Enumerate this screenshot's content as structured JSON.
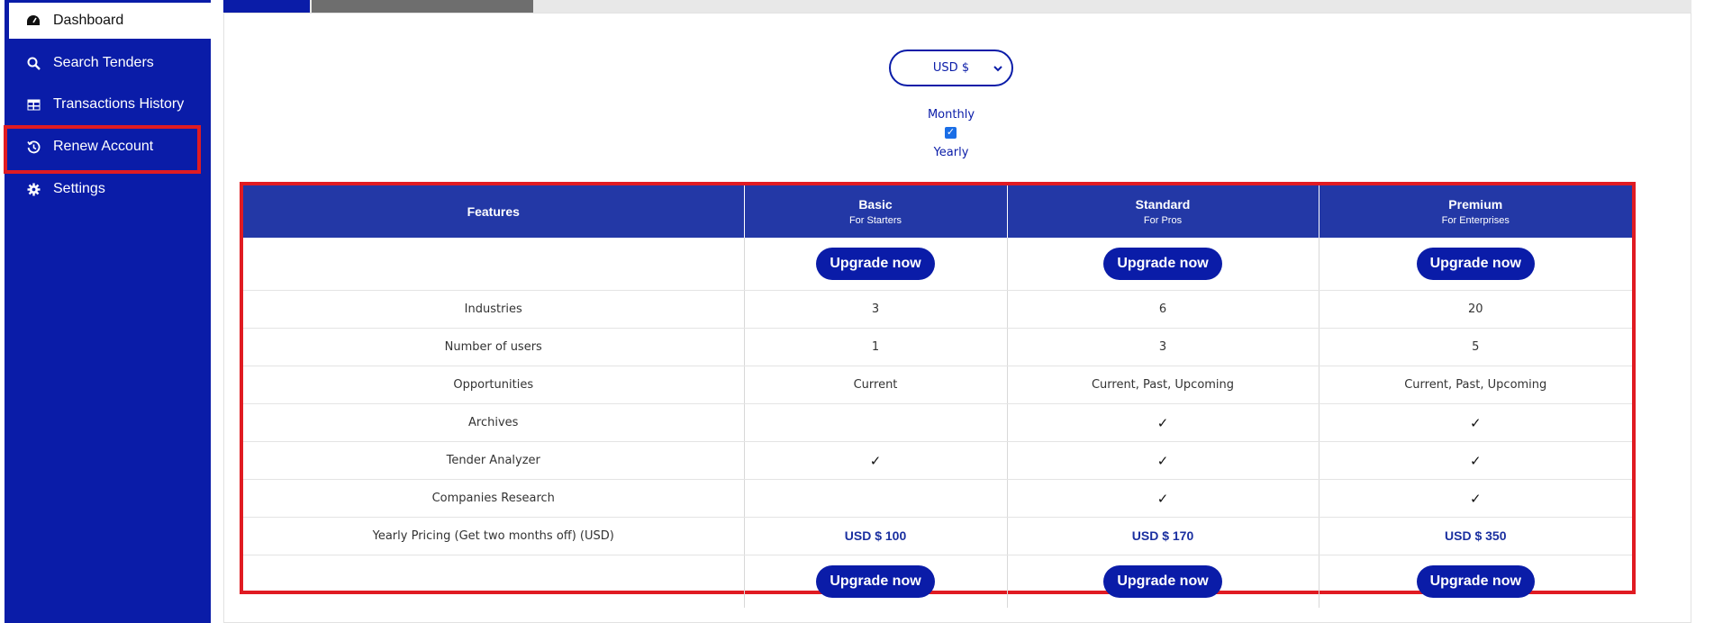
{
  "sidebar": {
    "items": [
      {
        "label": "Dashboard",
        "icon": "gauge-icon",
        "active": true
      },
      {
        "label": "Search Tenders",
        "icon": "search-icon"
      },
      {
        "label": "Transactions History",
        "icon": "table-icon"
      },
      {
        "label": "Renew Account",
        "icon": "history-icon",
        "highlighted": true
      },
      {
        "label": "Settings",
        "icon": "gear-icon"
      }
    ]
  },
  "controls": {
    "currency": "USD $",
    "monthly_label": "Monthly",
    "yearly_label": "Yearly",
    "yearly_checked": true
  },
  "plans": {
    "features_header": "Features",
    "columns": [
      {
        "name": "Basic",
        "tagline": "For Starters"
      },
      {
        "name": "Standard",
        "tagline": "For Pros"
      },
      {
        "name": "Premium",
        "tagline": "For Enterprises"
      }
    ],
    "upgrade_label": "Upgrade now",
    "rows": [
      {
        "feature": "Industries",
        "values": [
          "3",
          "6",
          "20"
        ]
      },
      {
        "feature": "Number of users",
        "values": [
          "1",
          "3",
          "5"
        ]
      },
      {
        "feature": "Opportunities",
        "values": [
          "Current",
          "Current, Past, Upcoming",
          "Current, Past, Upcoming"
        ]
      },
      {
        "feature": "Archives",
        "values": [
          "",
          "✓",
          "✓"
        ]
      },
      {
        "feature": "Tender Analyzer",
        "values": [
          "✓",
          "✓",
          "✓"
        ]
      },
      {
        "feature": "Companies Research",
        "values": [
          "",
          "✓",
          "✓"
        ]
      }
    ],
    "pricing": {
      "label": "Yearly Pricing (Get two months off) (USD)",
      "values": [
        "USD $ 100",
        "USD $ 170",
        "USD $ 350"
      ]
    }
  },
  "colors": {
    "brand": "#0a1ca8",
    "header": "#2338a6",
    "highlight": "#e01b22"
  }
}
